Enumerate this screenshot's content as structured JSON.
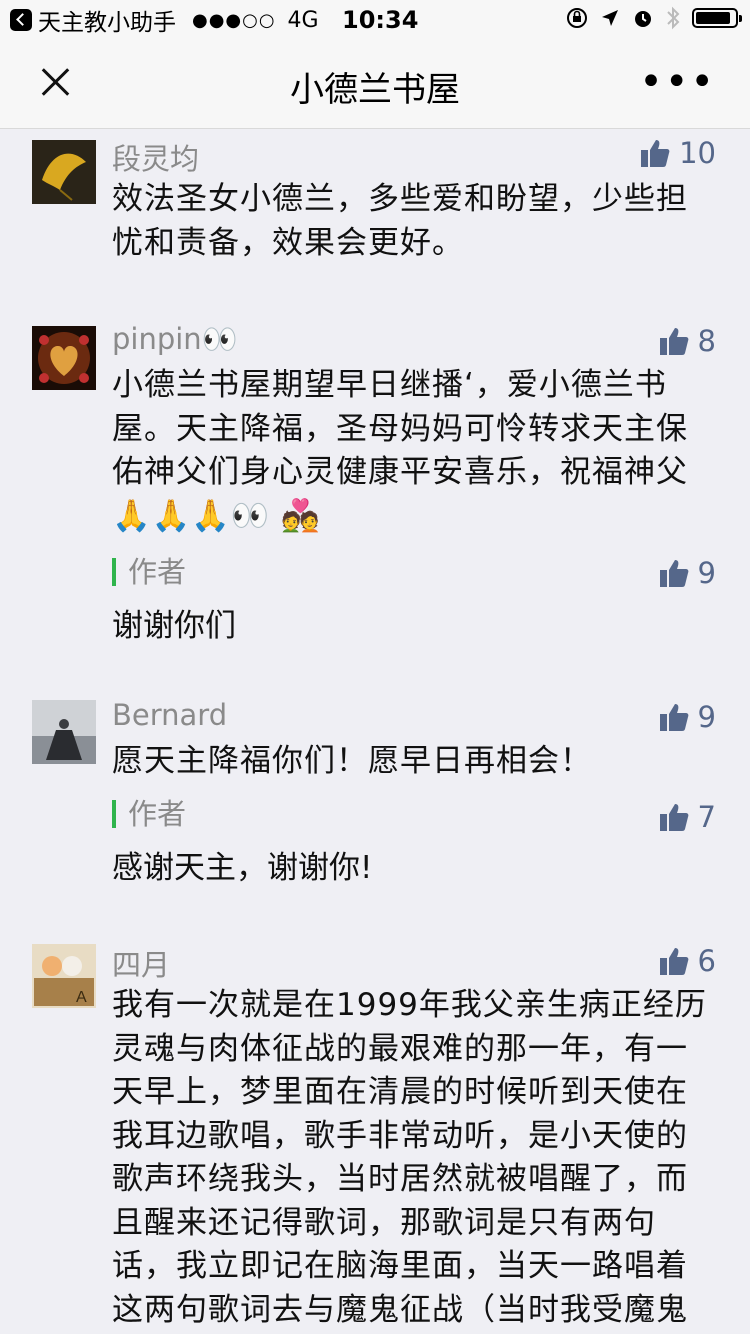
{
  "status_bar": {
    "carrier": "天主教小助手",
    "signal": "●●●○○",
    "network": "4G",
    "time": "10:34",
    "battery_level": 0.9
  },
  "nav": {
    "title": "小德兰书屋"
  },
  "comments": [
    {
      "nickname": "段灵均",
      "likes": "10",
      "text": "效法圣女小德兰，多些爱和盼望，少些担忧和责备，效果会更好。"
    },
    {
      "nickname": "pinpin👀",
      "likes": "8",
      "text": "小德兰书屋期望早日继播‘，爱小德兰书屋。天主降福，圣母妈妈可怜转求天主保佑神父们身心灵健康平安喜乐，祝福神父🙏🙏🙏👀 💑",
      "reply": {
        "label": "作者",
        "likes": "9",
        "text": "谢谢你们"
      }
    },
    {
      "nickname": "Bernard",
      "likes": "9",
      "text": "愿天主降福你们！愿早日再相会！",
      "reply": {
        "label": "作者",
        "likes": "7",
        "text": "感谢天主，谢谢你!"
      }
    },
    {
      "nickname": "四月",
      "likes": "6",
      "text": "我有一次就是在1999年我父亲生病正经历灵魂与肉体征战的最艰难的那一年，有一天早上，梦里面在清晨的时候听到天使在我耳边歌唱，歌手非常动听，是小天使的歌声环绕我头，当时居然就被唱醒了，而且醒来还记得歌词，那歌词是只有两句话，我立即记在脑海里面，当天一路唱着这两句歌词去与魔鬼征战（当时我受魔鬼"
    }
  ]
}
